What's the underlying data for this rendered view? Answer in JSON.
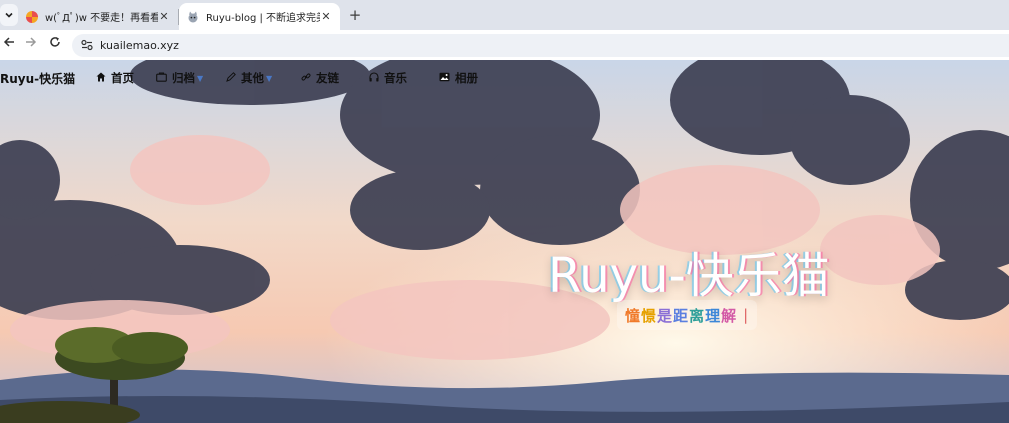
{
  "browser": {
    "tabs": [
      {
        "title": "w(ﾟДﾟ)w 不要走！再看看嘛！",
        "active": false,
        "favicon": "pinwheel-icon"
      },
      {
        "title": "Ruyu-blog | 不断追求完美的开",
        "active": true,
        "favicon": "cat-icon"
      }
    ],
    "url": "kuailemao.xyz"
  },
  "site": {
    "brand": "Ruyu-快乐猫",
    "nav": [
      {
        "label": "首页",
        "icon": "home-icon",
        "dropdown": false
      },
      {
        "label": "归档",
        "icon": "folder-icon",
        "dropdown": true
      },
      {
        "label": "其他",
        "icon": "pen-icon",
        "dropdown": true
      },
      {
        "label": "友链",
        "icon": "link-icon",
        "dropdown": false
      },
      {
        "label": "音乐",
        "icon": "headphones-icon",
        "dropdown": false
      },
      {
        "label": "相册",
        "icon": "image-icon",
        "dropdown": false
      }
    ],
    "hero": {
      "title": "Ruyu-快乐猫",
      "subtitle_chars": [
        "憧",
        "憬",
        "是",
        "距",
        "离",
        "理",
        "解"
      ],
      "cursor": "|"
    }
  },
  "colors": {
    "accent": "#4a78c6",
    "tabbar": "#dfe3eb",
    "omnibox": "#eef1f6"
  }
}
